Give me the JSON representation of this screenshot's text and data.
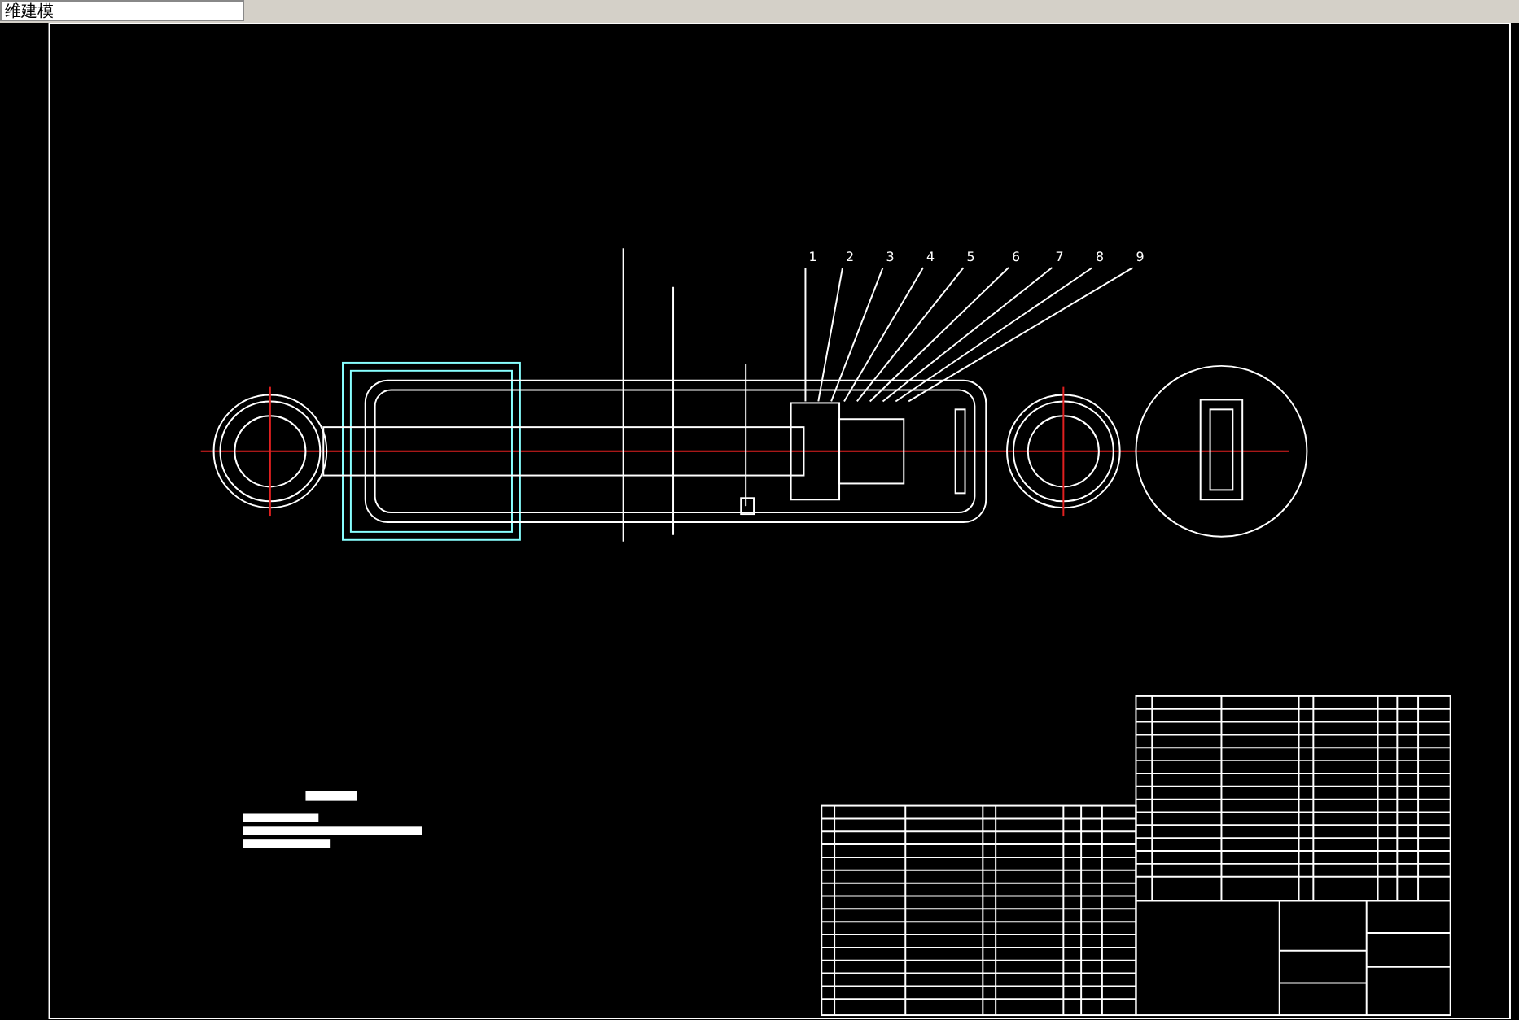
{
  "toolbar": {
    "workspace": "维建模"
  },
  "drawing": {
    "balloons": [
      {
        "label": "1"
      },
      {
        "label": "2"
      },
      {
        "label": "3"
      },
      {
        "label": "4"
      },
      {
        "label": "5"
      },
      {
        "label": "6"
      },
      {
        "label": "7"
      },
      {
        "label": "8"
      },
      {
        "label": "9"
      }
    ]
  }
}
